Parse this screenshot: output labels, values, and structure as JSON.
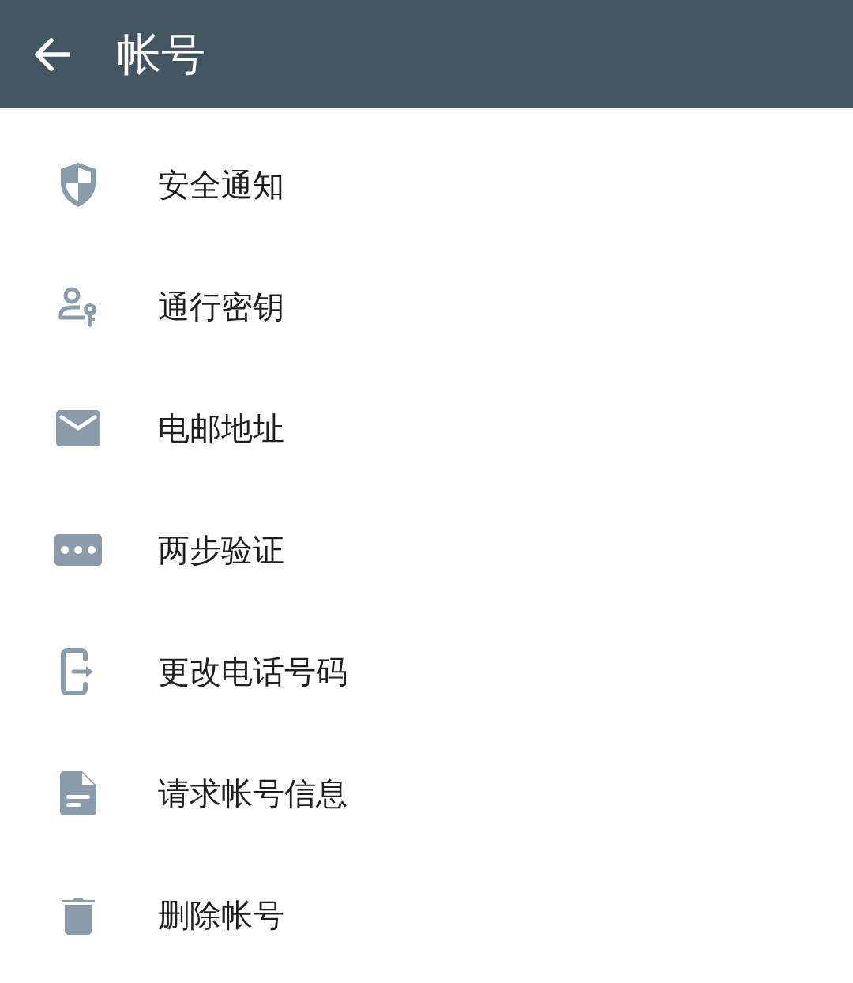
{
  "header": {
    "title": "帐号"
  },
  "items": [
    {
      "kind": "shield",
      "label": "安全通知"
    },
    {
      "kind": "passkey",
      "label": "通行密钥"
    },
    {
      "kind": "mail",
      "label": "电邮地址"
    },
    {
      "kind": "dots",
      "label": "两步验证"
    },
    {
      "kind": "phone",
      "label": "更改电话号码"
    },
    {
      "kind": "document",
      "label": "请求帐号信息"
    },
    {
      "kind": "trash",
      "label": "删除帐号"
    }
  ]
}
